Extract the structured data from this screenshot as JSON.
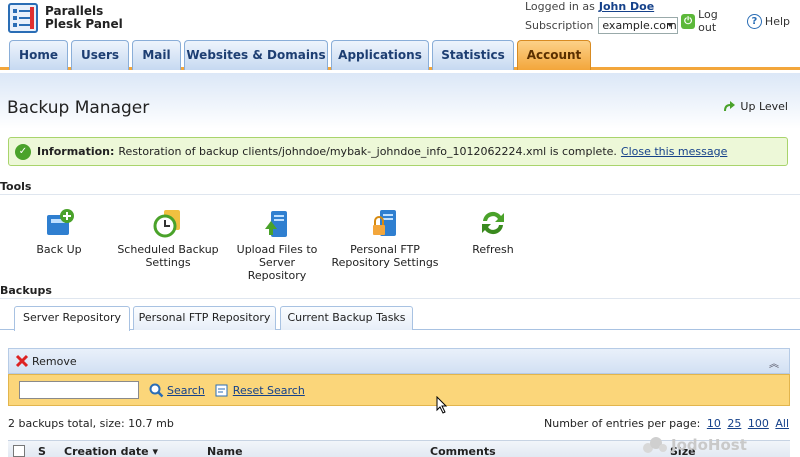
{
  "app": {
    "name_line1": "Parallels",
    "name_line2": "Plesk Panel"
  },
  "user": {
    "logged_label": "Logged in as",
    "name": "John Doe",
    "subscription_label": "Subscription",
    "subscription_value": "example.com"
  },
  "toplinks": {
    "logout": "Log out",
    "help": "Help"
  },
  "nav": {
    "tabs": [
      "Home",
      "Users",
      "Mail",
      "Websites & Domains",
      "Applications",
      "Statistics",
      "Account"
    ],
    "active": "Account"
  },
  "page": {
    "title": "Backup Manager",
    "up_level": "Up Level"
  },
  "info": {
    "label": "Information:",
    "text": "Restoration of backup clients/johndoe/mybak-_johndoe_info_1012062224.xml is complete.",
    "link": "Close this message"
  },
  "tools": {
    "label": "Tools",
    "items": [
      {
        "line1": "Back Up",
        "line2": "",
        "icon": "backup-icon"
      },
      {
        "line1": "Scheduled Backup",
        "line2": "Settings",
        "icon": "schedule-icon"
      },
      {
        "line1": "Upload Files to Server",
        "line2": "Repository",
        "icon": "upload-icon"
      },
      {
        "line1": "Personal FTP",
        "line2": "Repository Settings",
        "icon": "ftp-lock-icon"
      },
      {
        "line1": "Refresh",
        "line2": "",
        "icon": "refresh-icon"
      }
    ]
  },
  "backups": {
    "label": "Backups",
    "tabs": [
      "Server Repository",
      "Personal FTP Repository",
      "Current Backup Tasks"
    ],
    "active_tab": "Server Repository",
    "remove": "Remove",
    "search_button": "Search",
    "reset_search": "Reset Search",
    "search_value": "",
    "summary": "2 backups total, size: 10.7 mb",
    "perpage_label": "Number of entries per page:",
    "perpage_options": [
      "10",
      "25",
      "100",
      "All"
    ],
    "columns": [
      "S",
      "Creation date",
      "Name",
      "Comments",
      "Size"
    ]
  },
  "watermark": "JodoHost",
  "colors": {
    "accent_orange": "#f3a63b",
    "nav_blue": "#c6d9f1",
    "info_green": "#edf8d8",
    "search_yellow": "#fbd67a",
    "link": "#15418a"
  }
}
